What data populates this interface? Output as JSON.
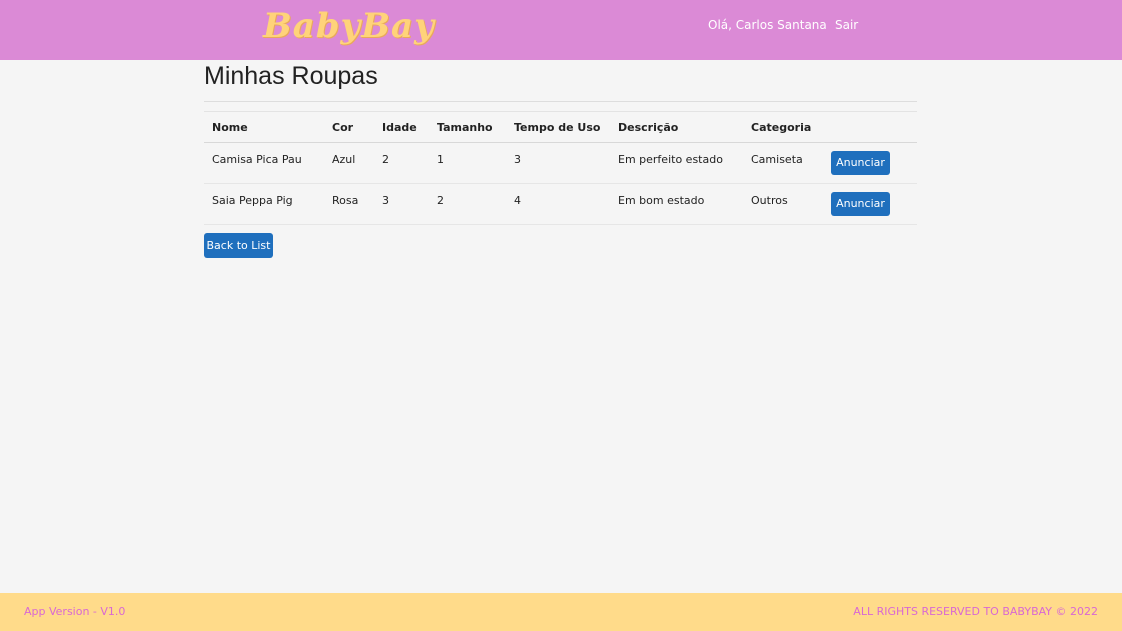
{
  "brand": {
    "logo_text": "BabyBay",
    "nav_bg": "#db8ad6",
    "logo_color": "#ffd37a",
    "footer_bg": "#ffdb8a",
    "footer_text_color": "#d968d3",
    "button_color": "#1f6fbd"
  },
  "nav": {
    "greeting": "Olá, Carlos Santana",
    "logout": "Sair"
  },
  "main": {
    "title": "Minhas Roupas",
    "table": {
      "headers": [
        "Nome",
        "Cor",
        "Idade",
        "Tamanho",
        "Tempo de Uso",
        "Descrição",
        "Categoria",
        ""
      ],
      "rows": [
        {
          "nome": "Camisa Pica Pau",
          "cor": "Azul",
          "idade": "2",
          "tamanho": "1",
          "tempo_uso": "3",
          "descricao": "Em perfeito estado",
          "categoria": "Camiseta",
          "action": "Anunciar"
        },
        {
          "nome": "Saia Peppa Pig",
          "cor": "Rosa",
          "idade": "3",
          "tamanho": "2",
          "tempo_uso": "4",
          "descricao": "Em bom estado",
          "categoria": "Outros",
          "action": "Anunciar"
        }
      ]
    },
    "back_label": "Back to List"
  },
  "footer": {
    "version": "App Version - V1.0",
    "rights": "ALL RIGHTS RESERVED TO BABYBAY © 2022"
  }
}
